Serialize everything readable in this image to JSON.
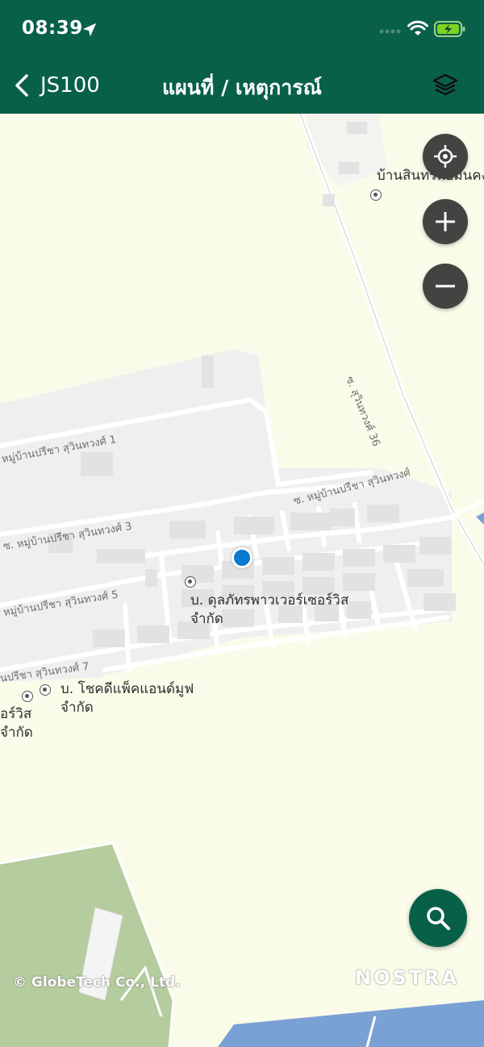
{
  "status_bar": {
    "time": "08:39"
  },
  "nav": {
    "back_label": "JS100",
    "title": "แผนที่ / เหตุการณ์"
  },
  "map": {
    "pois": [
      {
        "name": "บ้านสินทรพย์มั่นคง"
      },
      {
        "name": "บ. ดุลภัทรพาวเวอร์เซอร์วิส\nจำกัด"
      },
      {
        "name": "บ. โชคดีแพ็คแอนด์มูฟ\nจำกัด"
      },
      {
        "name": "อร์วิส\nจำกัด"
      }
    ],
    "roads": [
      "ซ. สุวินทวงศ์ 36",
      "หมู่บ้านปรีชา สุวินทวงศ์ 1",
      "ซ. หมู่บ้านปรีชา สุวินทวงศ์",
      "ซ. หมู่บ้านปรีชา สุวินทวงศ์ 3",
      "หมู่บ้านปรีชา สุวินทวงศ์ 5",
      "นปรีชา สุวินทวงศ์ 7"
    ],
    "copyright": "© GlobeTech Co., Ltd.",
    "brand": "NOSTRA"
  },
  "colors": {
    "header": "#086049",
    "map_background": "#fbfbea",
    "block": "#efefef",
    "park": "#b5cc9e",
    "water": "#7aa1d4",
    "user_location": "#0a7ad0",
    "control_button": "#444341"
  },
  "icons": {
    "location_arrow": "location-arrow-icon",
    "back": "chevron-left-icon",
    "layers": "layers-icon",
    "locate": "crosshair-icon",
    "zoom_in": "plus-icon",
    "zoom_out": "minus-icon",
    "search": "search-icon"
  }
}
